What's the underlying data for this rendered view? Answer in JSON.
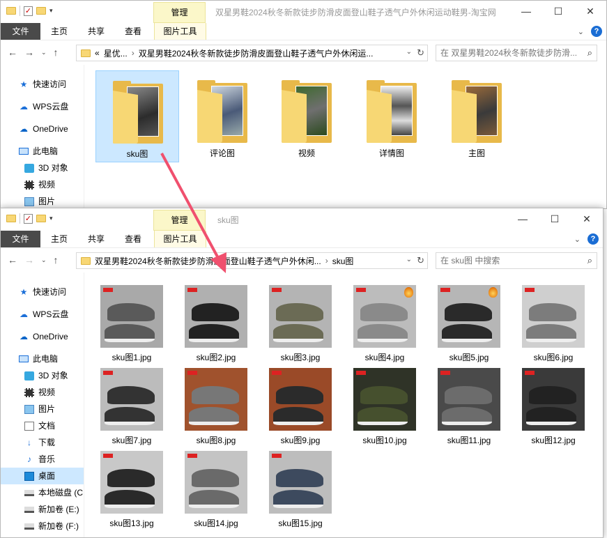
{
  "top_window": {
    "manage_tab": "管理",
    "title": "双星男鞋2024秋冬新款徒步防滑皮面登山鞋子透气户外休闲运动鞋男-淘宝网",
    "ribbon_tabs": [
      "文件",
      "主页",
      "共享",
      "查看",
      "图片工具"
    ],
    "address": {
      "prefix": "«",
      "crumbs": [
        "星优...",
        "双星男鞋2024秋冬新款徒步防滑皮面登山鞋子透气户外休闲运..."
      ]
    },
    "search_placeholder": "在 双星男鞋2024秋冬新款徒步防滑...",
    "nav_items": [
      "快速访问",
      "WPS云盘",
      "OneDrive",
      "此电脑",
      "3D 对象",
      "视频",
      "图片"
    ],
    "folders": [
      "sku图",
      "评论图",
      "视频",
      "详情图",
      "主图"
    ]
  },
  "bottom_window": {
    "manage_tab": "管理",
    "title": "sku图",
    "ribbon_tabs": [
      "文件",
      "主页",
      "共享",
      "查看",
      "图片工具"
    ],
    "address": {
      "crumbs": [
        "双星男鞋2024秋冬新款徒步防滑皮面登山鞋子透气户外休闲...",
        "sku图"
      ]
    },
    "search_placeholder": "在 sku图 中搜索",
    "nav_items": [
      "快速访问",
      "WPS云盘",
      "OneDrive",
      "此电脑",
      "3D 对象",
      "视频",
      "图片",
      "文档",
      "下载",
      "音乐",
      "桌面",
      "本地磁盘 (C",
      "新加卷 (E:)",
      "新加卷 (F:)"
    ],
    "files": [
      "sku图1.jpg",
      "sku图2.jpg",
      "sku图3.jpg",
      "sku图4.jpg",
      "sku图5.jpg",
      "sku图6.jpg",
      "sku图7.jpg",
      "sku图8.jpg",
      "sku图9.jpg",
      "sku图10.jpg",
      "sku图11.jpg",
      "sku图12.jpg",
      "sku图13.jpg",
      "sku图14.jpg",
      "sku图15.jpg"
    ]
  },
  "colors": {
    "selection": "#cce8ff",
    "file_tab": "#4a4a4a",
    "manage_tab": "#fbf7c9",
    "arrow": "#f0506e"
  }
}
